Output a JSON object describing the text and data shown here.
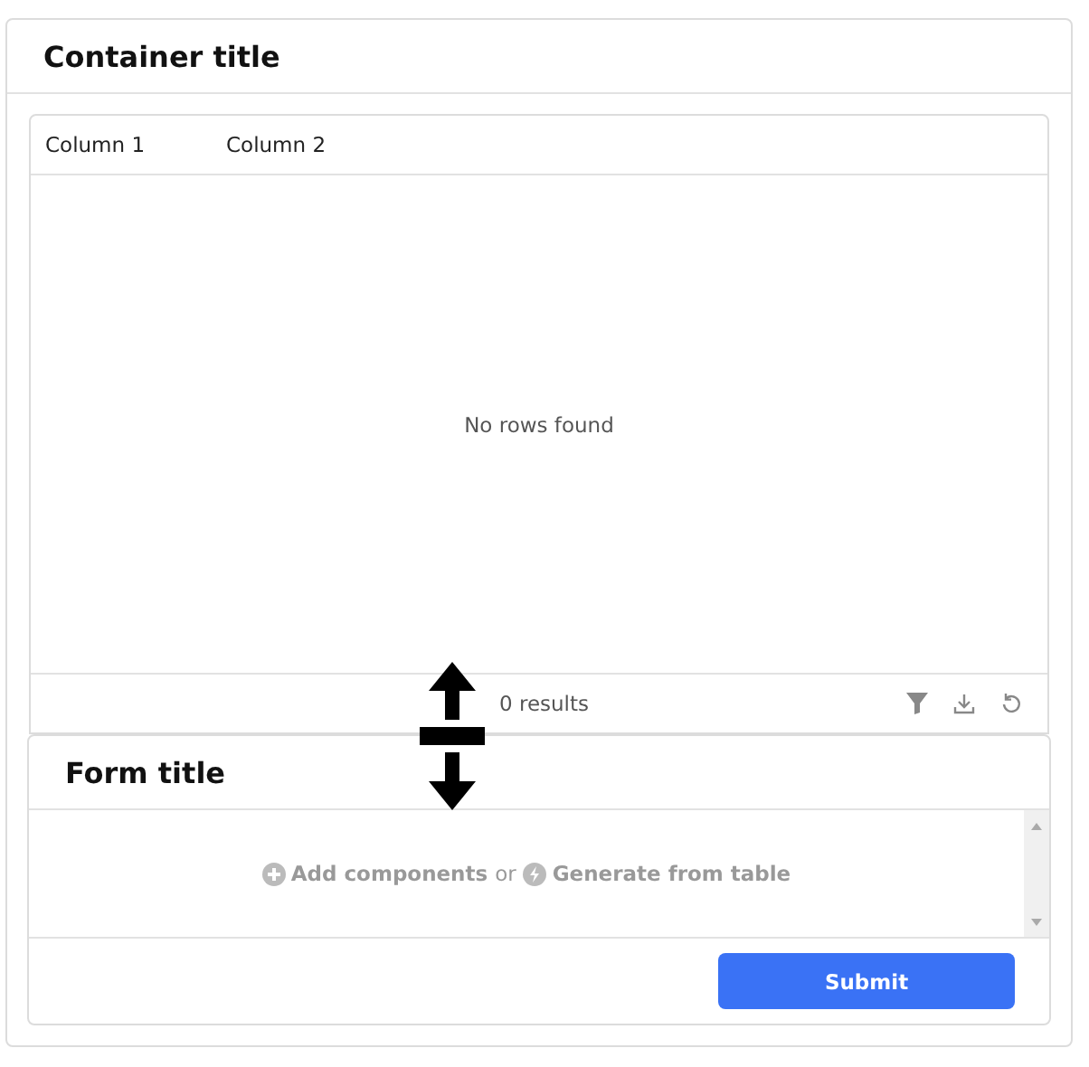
{
  "container": {
    "title": "Container title"
  },
  "table": {
    "columns": [
      "Column 1",
      "Column 2"
    ],
    "empty_message": "No rows found",
    "result_count": "0 results"
  },
  "form": {
    "title": "Form title",
    "add_link": "Add components",
    "separator": "or",
    "generate_link": "Generate from table",
    "submit": "Submit"
  }
}
